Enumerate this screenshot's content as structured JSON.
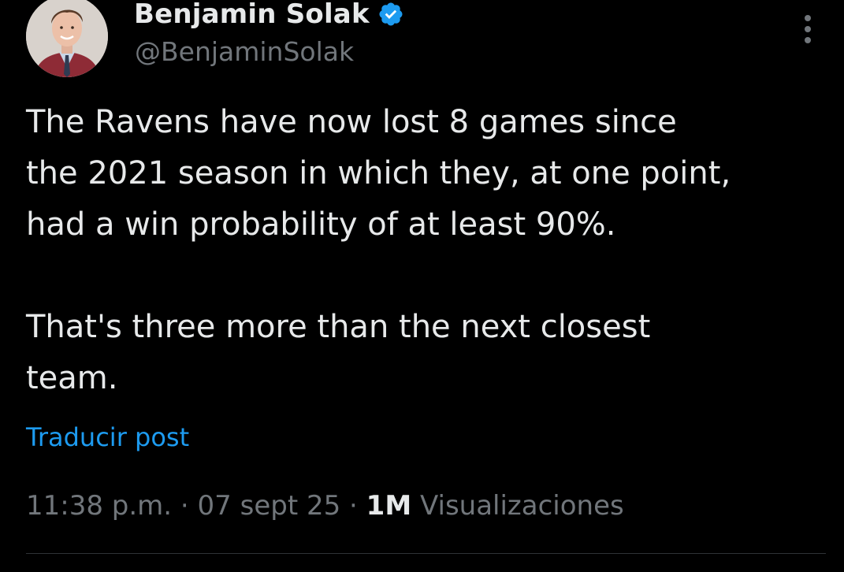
{
  "author": {
    "display_name": "Benjamin Solak",
    "handle": "@BenjaminSolak",
    "verified_icon": "verified-badge-icon",
    "verified_color": "#1d9bf0"
  },
  "tweet": {
    "lines_para1": [
      "The Ravens have now lost 8 games since",
      "the 2021 season in which they, at one point,",
      "had a win probability of at least 90%."
    ],
    "lines_para2": [
      "That's three more than the next closest",
      "team."
    ]
  },
  "translate_label": "Traducir post",
  "meta": {
    "time": "11:38 p.m.",
    "separator": " · ",
    "date": "07 sept 25",
    "views_count": "1M",
    "views_label": " Visualizaciones"
  },
  "icons": {
    "more": "more-vertical-icon"
  },
  "colors": {
    "background": "#000000",
    "text": "#e7e9ea",
    "muted": "#71767b",
    "link": "#1d9bf0"
  }
}
